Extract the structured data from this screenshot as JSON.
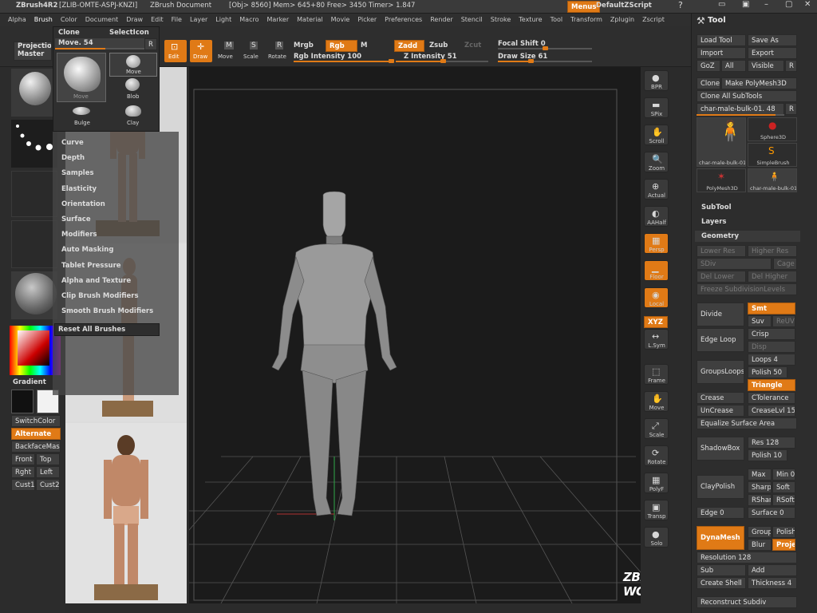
{
  "titlebar": {
    "app": "ZBrush4R2",
    "license": "[ZLIB-OMTE-ASPJ-KNZI]",
    "doc": "ZBrush Document",
    "stats": "[Obj> 8560] Mem> 645+80 Free> 3450 Timer> 1.847",
    "menus_label": "Menus",
    "script_label": "DefaultZScript"
  },
  "menubar": [
    "Alpha",
    "Brush",
    "Color",
    "Document",
    "Draw",
    "Edit",
    "File",
    "Layer",
    "Light",
    "Macro",
    "Marker",
    "Material",
    "Movie",
    "Picker",
    "Preferences",
    "Render",
    "Stencil",
    "Stroke",
    "Texture",
    "Tool",
    "Transform",
    "Zplugin",
    "Zscript"
  ],
  "shelf": {
    "projection_master": "Projection Master",
    "edit": "Edit",
    "draw": "Draw",
    "move": "Move",
    "scale": "Scale",
    "rotate": "Rotate",
    "mrgb": "Mrgb",
    "rgb": "Rgb",
    "m": "M",
    "rgb_intensity": "Rgb Intensity 100",
    "rgb_intensity_value": 100,
    "zadd": "Zadd",
    "zsub": "Zsub",
    "zcut": "Zcut",
    "z_intensity": "Z Intensity 51",
    "z_intensity_value": 51,
    "focal_shift": "Focal Shift 0",
    "draw_size": "Draw Size 61"
  },
  "brush_popup": {
    "clone": "Clone",
    "select_icon": "SelectIcon",
    "slider": "Move. 54",
    "slider_value": 54,
    "r": "R",
    "items": [
      "Move",
      "Move",
      "Blob",
      "Bulge",
      "Clay"
    ]
  },
  "brush_menu": {
    "items": [
      "Curve",
      "Depth",
      "Samples",
      "Elasticity",
      "Orientation",
      "Surface",
      "Modifiers",
      "Auto Masking",
      "Tablet Pressure",
      "Alpha and Texture",
      "Clip Brush Modifiers",
      "Smooth Brush Modifiers"
    ],
    "reset": "Reset All Brushes"
  },
  "left_shelf": {
    "gradient": "Gradient",
    "switch_color": "SwitchColor",
    "alternate": "Alternate",
    "backface": "BackfaceMas",
    "front": "Front",
    "top": "Top",
    "right": "Rght",
    "left": "Left",
    "cust1": "Cust1",
    "cust2": "Cust2",
    "main_color": "#111111",
    "secondary_color": "#f2f2f2"
  },
  "right_shelf": [
    "BPR",
    "SPix",
    "Scroll",
    "Zoom",
    "Actual",
    "AAHalf",
    "Persp",
    "Floor",
    "Local",
    "L.Sym",
    "Frame",
    "Move",
    "Scale",
    "Rotate",
    "PolyF",
    "Transp",
    "Solo"
  ],
  "right_shelf_xyz": "XYZ",
  "tray": {
    "title": "Tool",
    "load_tool": "Load Tool",
    "save_as": "Save As",
    "import": "Import",
    "export": "Export",
    "goz": "GoZ",
    "all": "All",
    "visible": "Visible",
    "r": "R",
    "clone": "Clone",
    "make_polymesh": "Make PolyMesh3D",
    "clone_all": "Clone All SubTools",
    "current_tool": "char-male-bulk-01. 48",
    "thumbs": [
      "char-male-bulk-01",
      "Sphere3D",
      "SimpleBrush",
      "PolyMesh3D",
      "char-male-bulk-01"
    ],
    "subtool": "SubTool",
    "layers": "Layers",
    "geometry": "Geometry",
    "lower_res": "Lower Res",
    "higher_res": "Higher Res",
    "sdiv": "SDiv",
    "cage": "Cage",
    "del_lower": "Del Lower",
    "del_higher": "Del Higher",
    "freeze": "Freeze SubdivisionLevels",
    "divide": "Divide",
    "smt": "Smt",
    "suv": "Suv",
    "reuv": "ReUV",
    "edge_loop": "Edge Loop",
    "crisp": "Crisp",
    "disp": "Disp",
    "groups_loops": "GroupsLoops",
    "loops": "Loops 4",
    "polish": "Polish 50",
    "triangle": "Triangle",
    "crease": "Crease",
    "ctolerance": "CTolerance",
    "uncrease": "UnCrease",
    "creaselvl": "CreaseLvl 15",
    "equalize": "Equalize Surface Area",
    "shadowbox": "ShadowBox",
    "res": "Res 128",
    "polish10": "Polish 10",
    "claypolish": "ClayPolish",
    "max": "Max",
    "min": "Min 0",
    "sharp": "Sharp",
    "soft": "Soft",
    "rshar": "RShar",
    "rsoft": "RSoft",
    "edge": "Edge 0",
    "surface": "Surface 0",
    "dynamesh": "DynaMesh",
    "group": "Group",
    "polish_lbl": "Polish",
    "blur": "Blur",
    "project": "Proje",
    "resolution": "Resolution 128",
    "sub": "Sub",
    "add": "Add",
    "create_shell": "Create Shell",
    "thickness": "Thickness 4",
    "reconstruct": "Reconstruct Subdiv"
  },
  "watermark": "ZBRUSH WORKSHOPS"
}
